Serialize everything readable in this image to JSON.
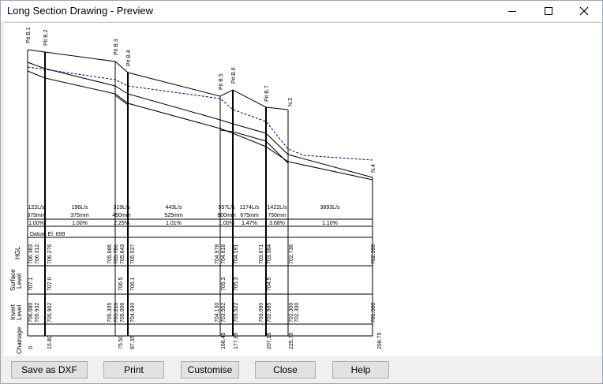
{
  "window": {
    "title": "Long Section Drawing - Preview",
    "minimize_icon": "minimize-icon",
    "maximize_icon": "maximize-icon",
    "close_icon": "close-icon"
  },
  "colors": {
    "hgl_line": "#00008b",
    "pit_marker": "#8b0057",
    "drawing": "#000000",
    "canvas": "#ffffff"
  },
  "pits": [
    "Pit B.1",
    "Pit B.2",
    "Pit B.3",
    "Pit B.4",
    "Pit B.5",
    "Pit B.6",
    "Pit B.7",
    "N.3",
    "N.4"
  ],
  "pipes": [
    {
      "flow": "122L/s",
      "size": "375mm",
      "grade": "1.00%"
    },
    {
      "flow": "196L/s",
      "size": "375mm",
      "grade": "1.00%"
    },
    {
      "flow": "319L/s",
      "size": "450mm",
      "grade": "2.25%"
    },
    {
      "flow": "443L/s",
      "size": "525mm",
      "grade": "1.01%"
    },
    {
      "flow": "557L/s",
      "size": "600mm",
      "grade": "1.00%"
    },
    {
      "flow": "1174L/s",
      "size": "675mm",
      "grade": "1.47%"
    },
    {
      "flow": "1422L/s",
      "size": "750mm",
      "grade": "3.68%"
    },
    {
      "flow": "3893L/s",
      "size": "",
      "grade": "1.10%"
    }
  ],
  "datum": "Datum El. 699",
  "rows": {
    "hgl": {
      "label": "HGL",
      "values": [
        "706.363",
        "706.312",
        "706.276",
        "705.886",
        "705.786",
        "705.643",
        "705.537",
        "704.978",
        "704.618",
        "704.191",
        "703.671",
        "703.384",
        "702.736",
        "702.398"
      ]
    },
    "surface": {
      "label_1": "Surface",
      "label_2": "Level",
      "values": [
        "707.1",
        "707.0",
        "706.5",
        "706.1",
        "705.3",
        "705.3",
        "704.5"
      ]
    },
    "invert": {
      "label_1": "Invert",
      "label_2": "Level",
      "values": [
        "706.080",
        "705.932",
        "705.902",
        "705.305",
        "705.216",
        "705.006",
        "704.930",
        "704.130",
        "703.552",
        "703.522",
        "703.090",
        "702.985",
        "702.300",
        "702.300",
        "701.500"
      ]
    },
    "chainage": {
      "label": "Chainage",
      "values": [
        "0",
        "15.80",
        "75.50",
        "87.35",
        "166.45",
        "177.85",
        "207.15",
        "225.75",
        "298.75"
      ]
    }
  },
  "buttons": {
    "save_dxf": "Save as DXF",
    "print": "Print",
    "customise": "Customise",
    "close": "Close",
    "help": "Help"
  }
}
